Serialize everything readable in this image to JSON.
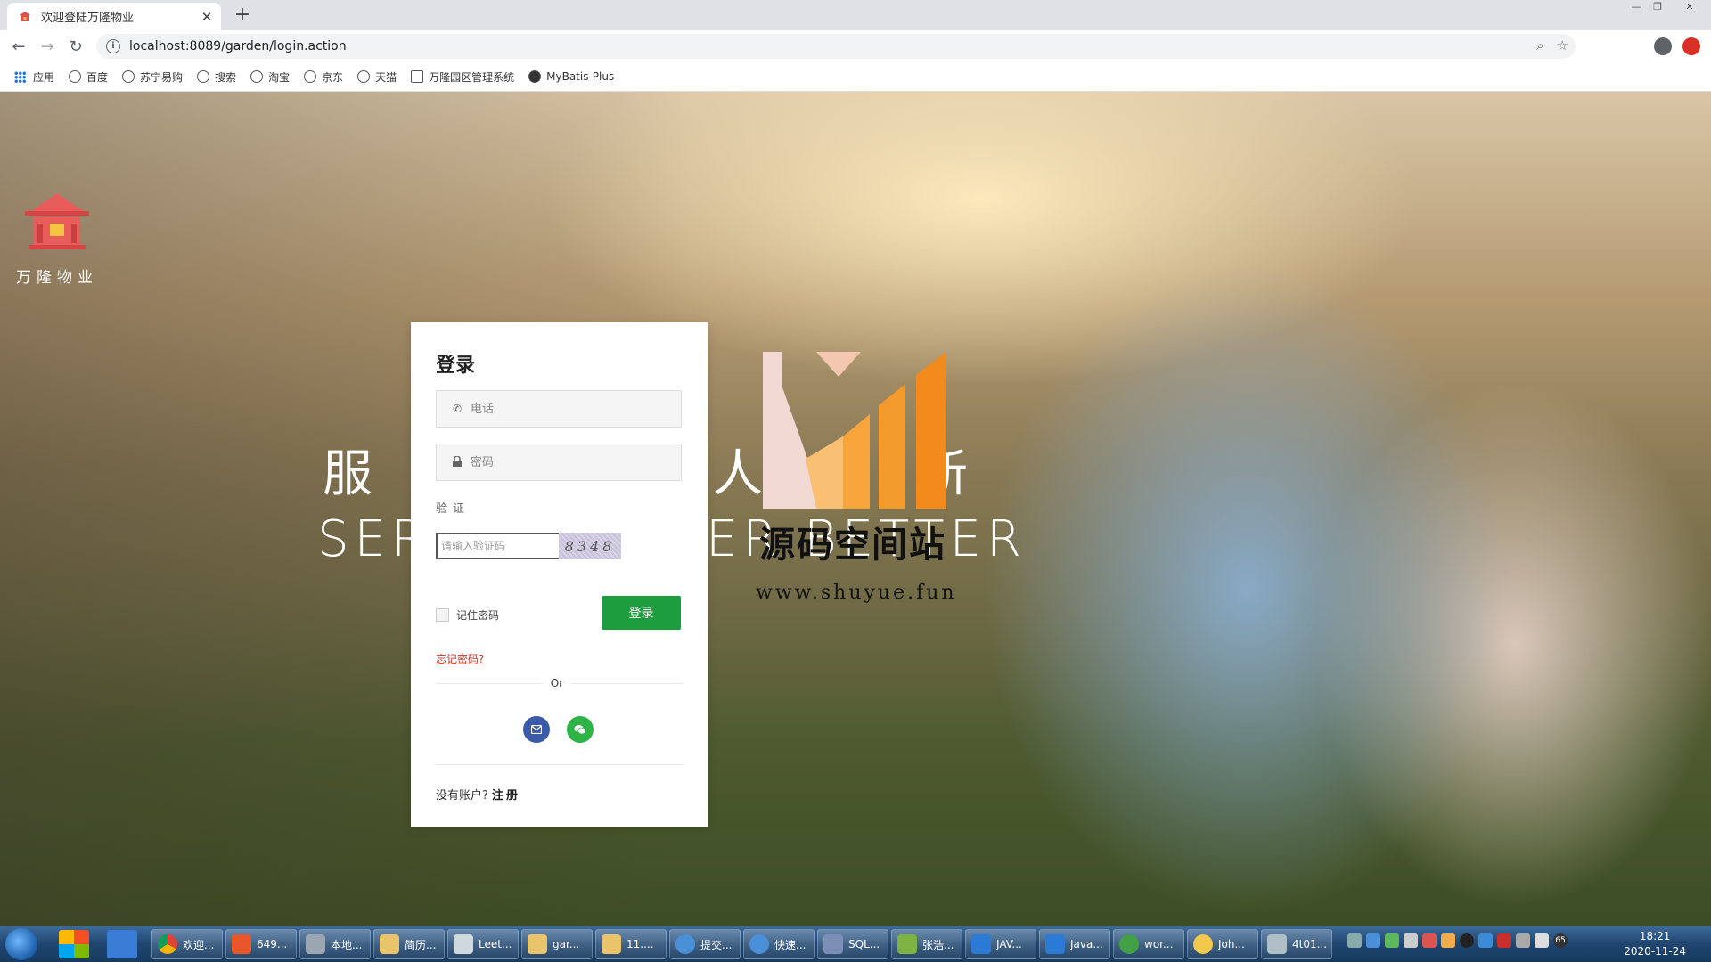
{
  "browser": {
    "tab_title": "欢迎登陆万隆物业",
    "url": "localhost:8089/garden/login.action",
    "bookmarks": [
      "应用",
      "百度",
      "苏宁易购",
      "搜索",
      "淘宝",
      "京东",
      "天猫",
      "万隆园区管理系统",
      "MyBatis-Plus"
    ]
  },
  "brand": {
    "name": "万隆物业"
  },
  "hero": {
    "slogan_cn_left": "服",
    "slogan_cn_mid": "人",
    "slogan_cn_right": "新",
    "slogan_en_left": "SER",
    "slogan_en_right": "ER BETTER"
  },
  "watermark": {
    "title": "源码空间站",
    "url": "www.shuyue.fun"
  },
  "login": {
    "title": "登录",
    "phone_placeholder": "电话",
    "password_placeholder": "密码",
    "verify_label": "验证",
    "captcha_placeholder": "请输入验证码",
    "captcha_code": "8348",
    "remember_label": "记住密码",
    "login_button": "登录",
    "forgot_link": "忘记密码?",
    "or_text": "Or",
    "no_account": "没有账户?",
    "signup_link": "注册"
  },
  "taskbar": {
    "items": [
      "欢迎...",
      "649...",
      "本地...",
      "简历...",
      "Leet...",
      "gar...",
      "11....",
      "提交...",
      "快速...",
      "SQL...",
      "张浩...",
      "JAV...",
      "Java...",
      "wor...",
      "Joh...",
      "4t01..."
    ],
    "tray_badge": "65",
    "time": "18:21",
    "date": "2020-11-24"
  },
  "colors": {
    "login_button": "#1e9d3f",
    "forgot_link": "#c0392b",
    "mail_button": "#3b5aa8",
    "wechat_button": "#2fb346"
  }
}
